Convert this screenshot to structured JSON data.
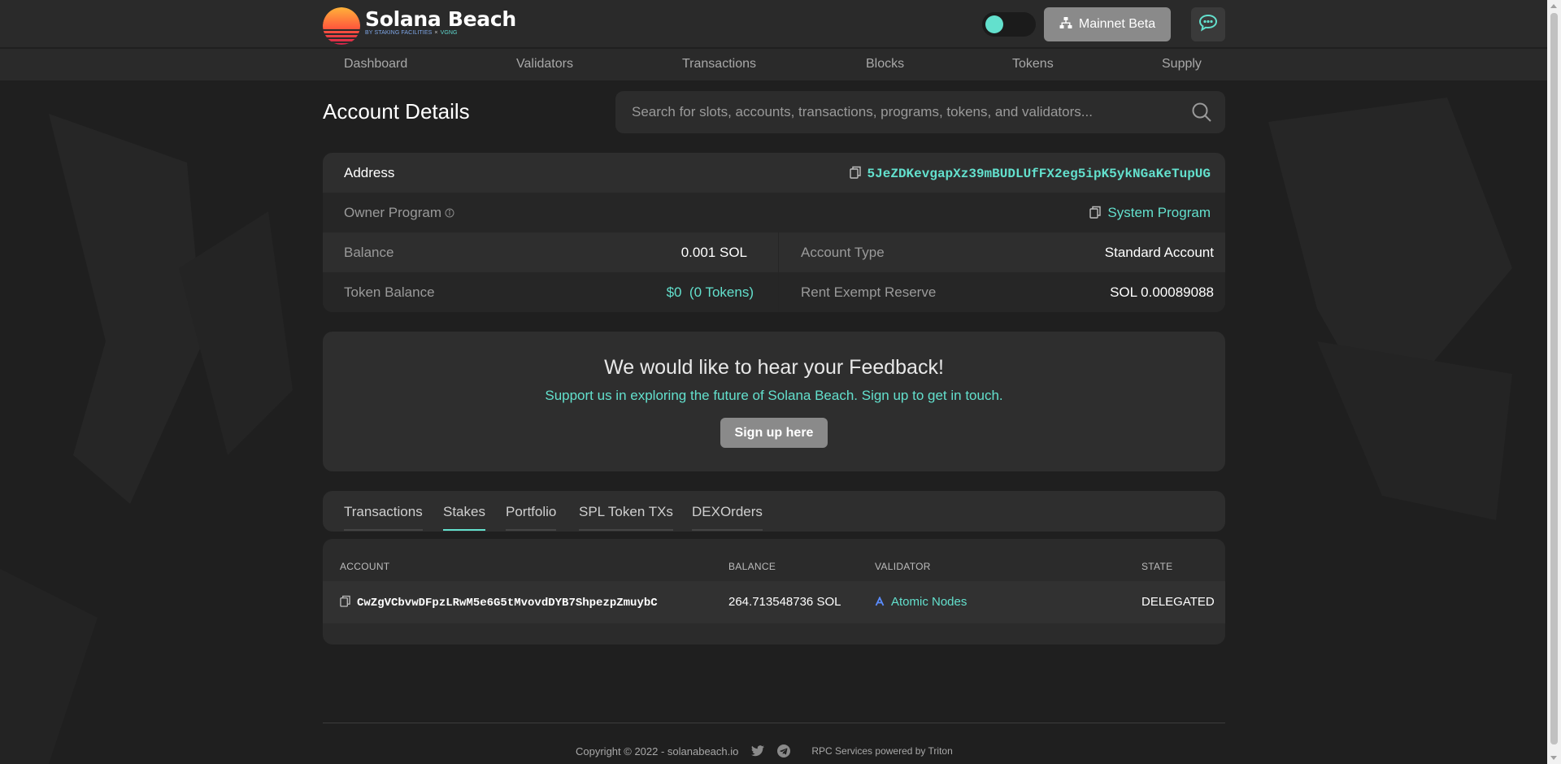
{
  "brand": {
    "name": "Solana Beach",
    "sub_left": "BY STAKING FACILITIES",
    "sub_sep": "×",
    "sub_right": "VGNG"
  },
  "header": {
    "network_label": "Mainnet Beta",
    "theme_toggle_on": true
  },
  "nav": {
    "items": [
      {
        "label": "Dashboard"
      },
      {
        "label": "Validators"
      },
      {
        "label": "Transactions"
      },
      {
        "label": "Blocks"
      },
      {
        "label": "Tokens"
      },
      {
        "label": "Supply"
      }
    ]
  },
  "page": {
    "title": "Account Details",
    "search_placeholder": "Search for slots, accounts, transactions, programs, tokens, and validators..."
  },
  "details": {
    "address_label": "Address",
    "address_value": "5JeZDKevgapXz39mBUDLUfFX2eg5ipK5ykNGaKeTupUG",
    "owner_label": "Owner Program",
    "owner_value": "System Program",
    "balance_label": "Balance",
    "balance_value": "0.001 SOL",
    "account_type_label": "Account Type",
    "account_type_value": "Standard Account",
    "token_balance_label": "Token Balance",
    "token_balance_value": "$0  (0 Tokens)",
    "rent_label": "Rent Exempt Reserve",
    "rent_value": "SOL 0.00089088"
  },
  "feedback": {
    "title": "We would like to hear your Feedback!",
    "subtitle": "Support us in exploring the future of Solana Beach. Sign up to get in touch.",
    "button": "Sign up here"
  },
  "tabs": [
    {
      "label": "Transactions",
      "active": false
    },
    {
      "label": "Stakes",
      "active": true
    },
    {
      "label": "Portfolio",
      "active": false
    },
    {
      "label": "SPL Token TXs",
      "active": false
    },
    {
      "label": "DEXOrders",
      "active": false
    }
  ],
  "stakes_table": {
    "headers": [
      "ACCOUNT",
      "BALANCE",
      "VALIDATOR",
      "STATE"
    ],
    "rows": [
      {
        "account": "CwZgVCbvwDFpzLRwM5e6G5tMvovdDYB7ShpezpZmuybC",
        "balance": "264.713548736 SOL",
        "validator": "Atomic Nodes",
        "state": "DELEGATED"
      }
    ]
  },
  "footer": {
    "copyright": "Copyright © 2022 - solanabeach.io",
    "rpc": "RPC Services powered by Triton"
  },
  "colors": {
    "accent": "#63e0cd",
    "background": "#1f1f1f",
    "card": "#2b2b2b",
    "button": "#8a8a8a"
  }
}
